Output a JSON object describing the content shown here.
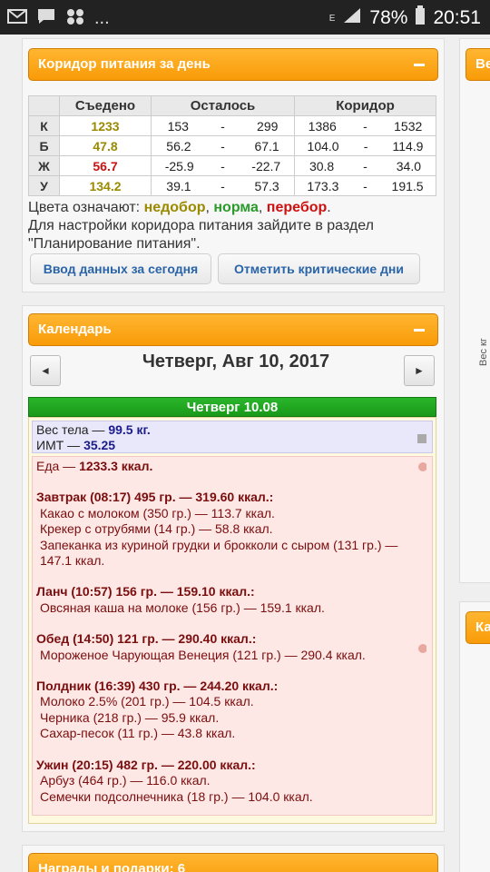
{
  "status": {
    "battery": "78%",
    "time": "20:51",
    "ellipsis": "..."
  },
  "corridor": {
    "title": "Коридор питания за день",
    "headers": [
      "",
      "Съедено",
      "Осталось",
      "Коридор"
    ],
    "rows": [
      {
        "label": "К",
        "eaten": "1233",
        "left_min": "153",
        "left_max": "299",
        "corr_min": "1386",
        "corr_max": "1532",
        "color": "#9a8a00"
      },
      {
        "label": "Б",
        "eaten": "47.8",
        "left_min": "56.2",
        "left_max": "67.1",
        "corr_min": "104.0",
        "corr_max": "114.9",
        "color": "#9a8a00"
      },
      {
        "label": "Ж",
        "eaten": "56.7",
        "left_min": "-25.9",
        "left_max": "-22.7",
        "corr_min": "30.8",
        "corr_max": "34.0",
        "color": "#cc1111"
      },
      {
        "label": "У",
        "eaten": "134.2",
        "left_min": "39.1",
        "left_max": "57.3",
        "corr_min": "173.3",
        "corr_max": "191.5",
        "color": "#9a8a00"
      }
    ],
    "dash": "-",
    "legend_prefix": "Цвета означают: ",
    "legend_under": "недобор",
    "legend_sep1": ", ",
    "legend_norm": "норма",
    "legend_sep2": ", ",
    "legend_over": "перебор",
    "legend_end": ".",
    "hint": "Для настройки коридора питания зайдите в раздел \"Планирование питания\".",
    "btn_enter": "Ввод данных за сегодня",
    "btn_critical": "Отметить критические дни"
  },
  "calendar": {
    "title": "Календарь",
    "date": "Четверг, Авг 10, 2017",
    "prev": "◄",
    "next": "►",
    "day_header": "Четверг 10.08",
    "weight_label": "Вес тела — ",
    "weight_value": "99.5 кг.",
    "bmi_label": "ИМТ — ",
    "bmi_value": "35.25",
    "food_label": "Еда — ",
    "food_value": "1233.3 ккал.",
    "meals": [
      {
        "title": "Завтрак (08:17) 495 гр. — 319.60 ккал.:",
        "items": [
          "Какао с молоком (350 гр.) — 113.7 ккал.",
          "Крекер с отрубями (14 гр.) — 58.8 ккал.",
          "Запеканка из куриной грудки и брокколи с сыром (131 гр.) — 147.1 ккал."
        ]
      },
      {
        "title": "Ланч (10:57) 156 гр. — 159.10 ккал.:",
        "items": [
          "Овсяная каша на молоке (156 гр.) — 159.1 ккал."
        ]
      },
      {
        "title": "Обед (14:50) 121 гр. — 290.40 ккал.:",
        "items": [
          "Мороженое Чарующая Венеция (121 гр.) — 290.4 ккал."
        ]
      },
      {
        "title": "Полдник (16:39) 430 гр. — 244.20 ккал.:",
        "items": [
          "Молоко 2.5% (201 гр.) — 104.5 ккал.",
          "Черника (218 гр.) — 95.9 ккал.",
          "Сахар-песок (11 гр.) — 43.8 ккал."
        ]
      },
      {
        "title": "Ужин (20:15) 482 гр. — 220.00 ккал.:",
        "items": [
          "Арбуз (464 гр.) — 116.0 ккал.",
          "Семечки подсолнечника (18 гр.) — 104.0 ккал."
        ]
      }
    ]
  },
  "bottom_widget_title": "Награды и подарки: 6",
  "right_widget_title_1": "Ве",
  "right_widget_title_2": "Ка",
  "right_widget_vertical": "Вес кг"
}
